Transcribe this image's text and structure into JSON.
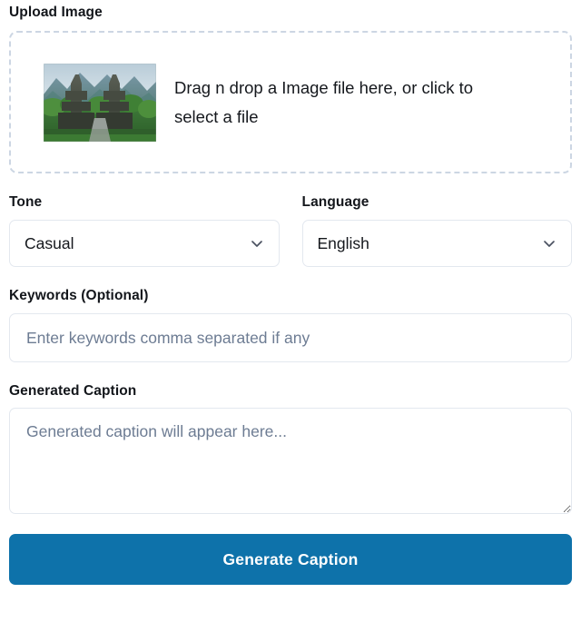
{
  "upload": {
    "label": "Upload Image",
    "dropzone_text": "Drag n drop a Image file here, or click to select a file",
    "thumbnail_alt": "balinese-temple-gate-thumbnail"
  },
  "tone": {
    "label": "Tone",
    "value": "Casual",
    "icon": "chevron-down-icon"
  },
  "language": {
    "label": "Language",
    "value": "English",
    "icon": "chevron-down-icon"
  },
  "keywords": {
    "label": "Keywords (Optional)",
    "value": "",
    "placeholder": "Enter keywords comma separated if any"
  },
  "caption": {
    "label": "Generated Caption",
    "value": "",
    "placeholder": "Generated caption will appear here..."
  },
  "action": {
    "generate_label": "Generate Caption"
  },
  "colors": {
    "primary": "#0e72aa",
    "border": "#e3e8ef",
    "dashed_border": "#ccd6e3",
    "placeholder": "#6d7c93",
    "text": "#15181d"
  }
}
